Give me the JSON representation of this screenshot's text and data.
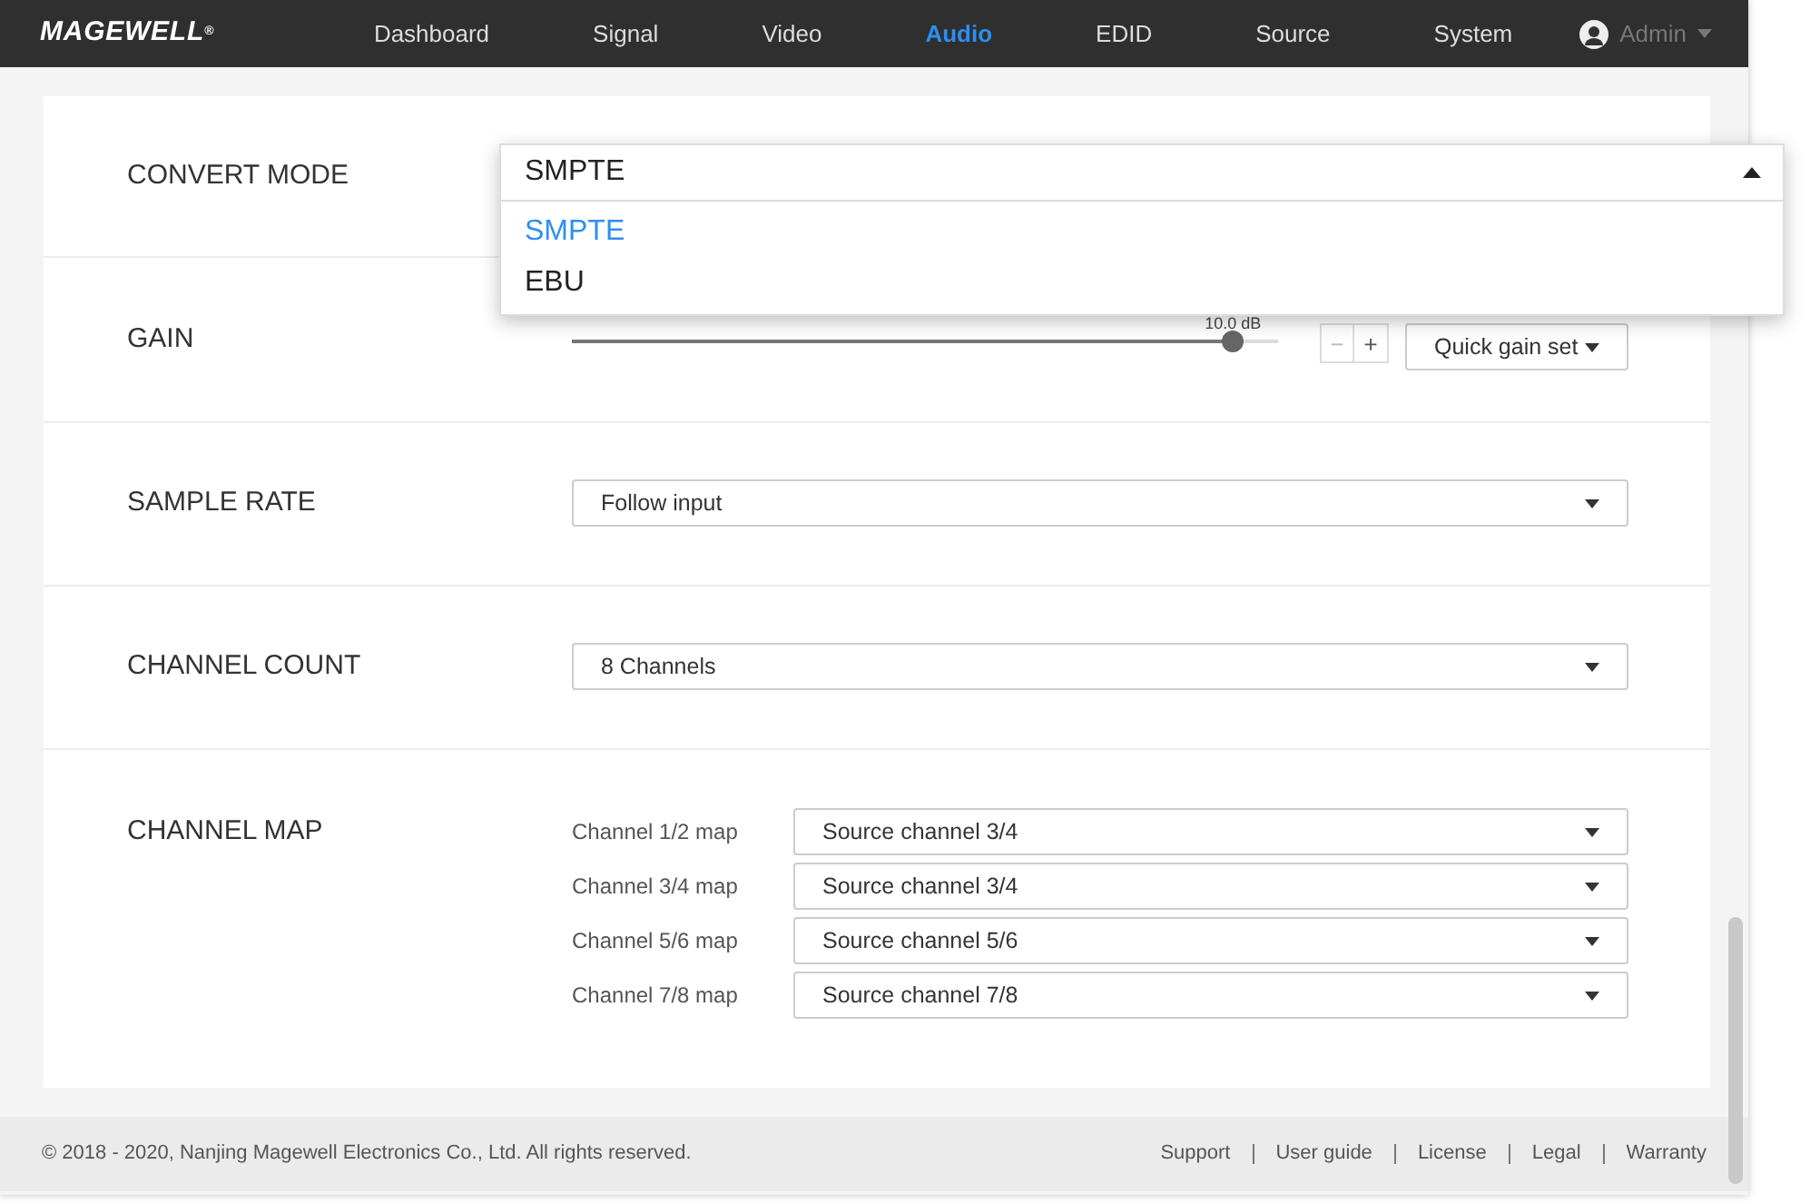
{
  "header": {
    "logo": "MAGEWELL$^{®}$",
    "nav": [
      {
        "label": "Dashboard",
        "selected": false
      },
      {
        "label": "Signal",
        "selected": false
      },
      {
        "label": "Video",
        "selected": false
      },
      {
        "label": "Audio",
        "selected": true
      },
      {
        "label": "EDID",
        "selected": false
      },
      {
        "label": "Source",
        "selected": false
      },
      {
        "label": "System",
        "selected": false
      }
    ],
    "user": "Admin"
  },
  "settings": [
    {
      "kind": "select",
      "label": "CONVERT MODE",
      "value": "SMPTE",
      "expanded": true,
      "options": [
        {
          "label": "SMPTE",
          "selected": true
        },
        {
          "label": "EBU",
          "selected": false
        }
      ]
    },
    {
      "kind": "gain",
      "label": "GAIN",
      "reading": "10.0 dB",
      "level": 0.936,
      "minus": "−",
      "plus": "+",
      "quick": "Quick gain set"
    },
    {
      "kind": "select",
      "label": "SAMPLE RATE",
      "value": "Follow input",
      "expanded": false
    },
    {
      "kind": "select",
      "label": "CHANNEL COUNT",
      "value": "8 Channels",
      "expanded": false
    },
    {
      "kind": "map",
      "label": "CHANNEL MAP",
      "maps": [
        {
          "label": "Channel 1/2 map",
          "value": "Source channel 3/4"
        },
        {
          "label": "Channel 3/4 map",
          "value": "Source channel 3/4"
        },
        {
          "label": "Channel 5/6 map",
          "value": "Source channel 5/6"
        },
        {
          "label": "Channel 7/8 map",
          "value": "Source channel 7/8"
        }
      ]
    }
  ],
  "footer": {
    "copyright": "© 2018 - 2020, Nanjing Magewell Electronics Co., Ltd. All rights reserved.",
    "links": [
      "Support",
      "User guide",
      "License",
      "Legal",
      "Warranty"
    ]
  }
}
